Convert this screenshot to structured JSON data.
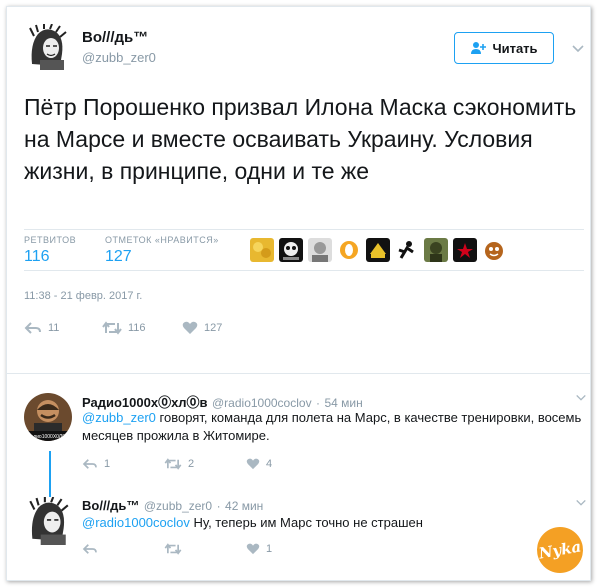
{
  "tweet": {
    "author_name": "Во///дь™",
    "author_handle": "@zubb_zer0",
    "follow_label": "Читать",
    "text": "Пётр Порошенко призвал Илона Маска сэкономить на Марсе и вместе осваивать Украину. Условия жизни, в принципе, одни и те же",
    "retweets_label": "РЕТВИТОВ",
    "retweets_count": "116",
    "likes_label": "ОТМЕТОК «НРАВИТСЯ»",
    "likes_count": "127",
    "timestamp": "11:38 - 21 февр. 2017 г.",
    "actions": {
      "replies": "11",
      "retweets": "116",
      "likes": "127"
    }
  },
  "replies": [
    {
      "author_name": "Радио1000х⓪хл⓪в",
      "author_handle": "@radio1000coclov",
      "time": "54 мин",
      "mention": "@zubb_zer0",
      "text": "говорят, команда для полета на Марс, в качестве тренировки, восемь месяцев прожила в Житомире.",
      "avatar_caption": "радио1000Х0Л0В",
      "actions": {
        "replies": "1",
        "retweets": "2",
        "likes": "4"
      }
    },
    {
      "author_name": "Во///дь™",
      "author_handle": "@zubb_zer0",
      "time": "42 мин",
      "mention": "@radio1000coclov",
      "text": "Ну, теперь им Марс точно не страшен",
      "actions": {
        "replies": "",
        "retweets": "",
        "likes": "1"
      }
    }
  ],
  "watermark": "Nyka",
  "colors": {
    "accent": "#1da1f2",
    "muted": "#8899a6",
    "text": "#14171a"
  },
  "icons": [
    "person-add-icon",
    "chevron-down-icon",
    "reply-icon",
    "retweet-icon",
    "heart-icon"
  ]
}
